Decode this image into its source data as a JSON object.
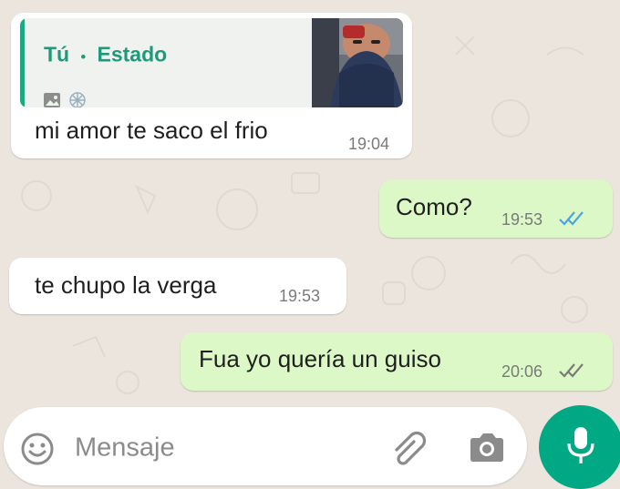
{
  "colors": {
    "background": "#ebe5dd",
    "incoming_bubble": "#ffffff",
    "outgoing_bubble": "#dcf8c6",
    "accent": "#00a884",
    "quote_author": "#1d9a7a",
    "read_ticks": "#4fa3e0",
    "delivered_ticks": "#7a7a7a"
  },
  "messages": [
    {
      "direction": "incoming",
      "quoted_status": {
        "author": "Tú",
        "separator": "•",
        "label": "Estado",
        "icons": [
          "image-icon",
          "sticker-icon"
        ]
      },
      "text": "mi amor te saco el frio",
      "time": "19:04"
    },
    {
      "direction": "outgoing",
      "text": "Como?",
      "time": "19:53",
      "status": "read",
      "status_icon": "double-check-icon"
    },
    {
      "direction": "incoming",
      "text": "te chupo la verga",
      "time": "19:53"
    },
    {
      "direction": "outgoing",
      "text": "Fua yo quería un guiso",
      "time": "20:06",
      "status": "delivered",
      "status_icon": "double-check-icon"
    }
  ],
  "input_bar": {
    "placeholder": "Mensaje",
    "icons": [
      "emoji-icon",
      "attach-icon",
      "camera-icon",
      "mic-icon"
    ]
  }
}
